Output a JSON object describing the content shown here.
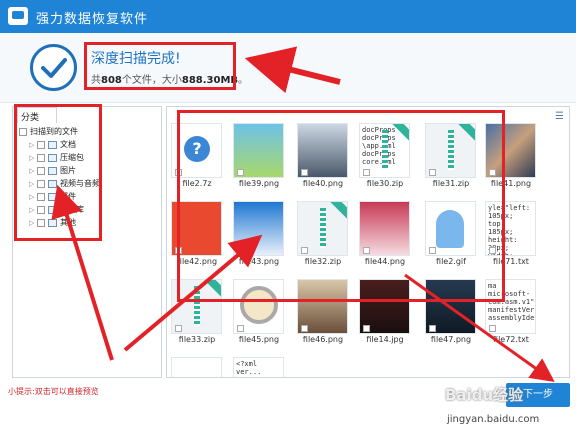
{
  "window": {
    "title": "强力数据恢复软件"
  },
  "summary": {
    "title": "深度扫描完成!",
    "stats_prefix": "共",
    "file_count": "808",
    "stats_middle": "个文件，大小",
    "total_size": "888.30MB",
    "stats_suffix": "。"
  },
  "sidebar": {
    "tab_label": "分类",
    "root_label": "扫描到的文件",
    "items": [
      {
        "label": "文档",
        "icon": "document-icon"
      },
      {
        "label": "压缩包",
        "icon": "archive-icon"
      },
      {
        "label": "图片",
        "icon": "image-icon"
      },
      {
        "label": "视频与音频",
        "icon": "video-icon"
      },
      {
        "label": "邮件",
        "icon": "mail-icon"
      },
      {
        "label": "数据库",
        "icon": "database-icon"
      },
      {
        "label": "其他",
        "icon": "other-icon"
      }
    ]
  },
  "files": [
    {
      "name": "file2.7z"
    },
    {
      "name": "file39.png"
    },
    {
      "name": "file40.png"
    },
    {
      "name": "file30.zip",
      "content": [
        "docProps",
        "docProps",
        "\\app.xml",
        "docProps",
        "core.xml"
      ]
    },
    {
      "name": "file31.zip"
    },
    {
      "name": "file41.png"
    },
    {
      "name": "file42.png"
    },
    {
      "name": "file43.png"
    },
    {
      "name": "file32.zip"
    },
    {
      "name": "file44.png"
    },
    {
      "name": "file2.gif"
    },
    {
      "name": "file71.txt",
      "content": [
        "yle=\"left:",
        "105px; top:",
        "185px; height:",
        "30px; width:",
        "10px;\">"
      ]
    },
    {
      "name": "file33.zip"
    },
    {
      "name": "file45.png"
    },
    {
      "name": "file46.png"
    },
    {
      "name": "file14.jpg"
    },
    {
      "name": "file47.png"
    },
    {
      "name": "file72.txt",
      "content": [
        "ma",
        "microsoft-",
        "com:asm.v1\"",
        "manifestVersi",
        "assemblyIde"
      ]
    },
    {
      "name": "",
      "content": []
    },
    {
      "name": "",
      "content": [
        "<?xml",
        "ver..."
      ]
    }
  ],
  "footer": {
    "tip": "小提示:双击可以直接预览",
    "next_label": "下一步"
  },
  "watermark": {
    "logo": "Baidu经验",
    "url": "jingyan.baidu.com"
  },
  "colors": {
    "accent": "#1f84d6",
    "annotation": "#e32227"
  }
}
